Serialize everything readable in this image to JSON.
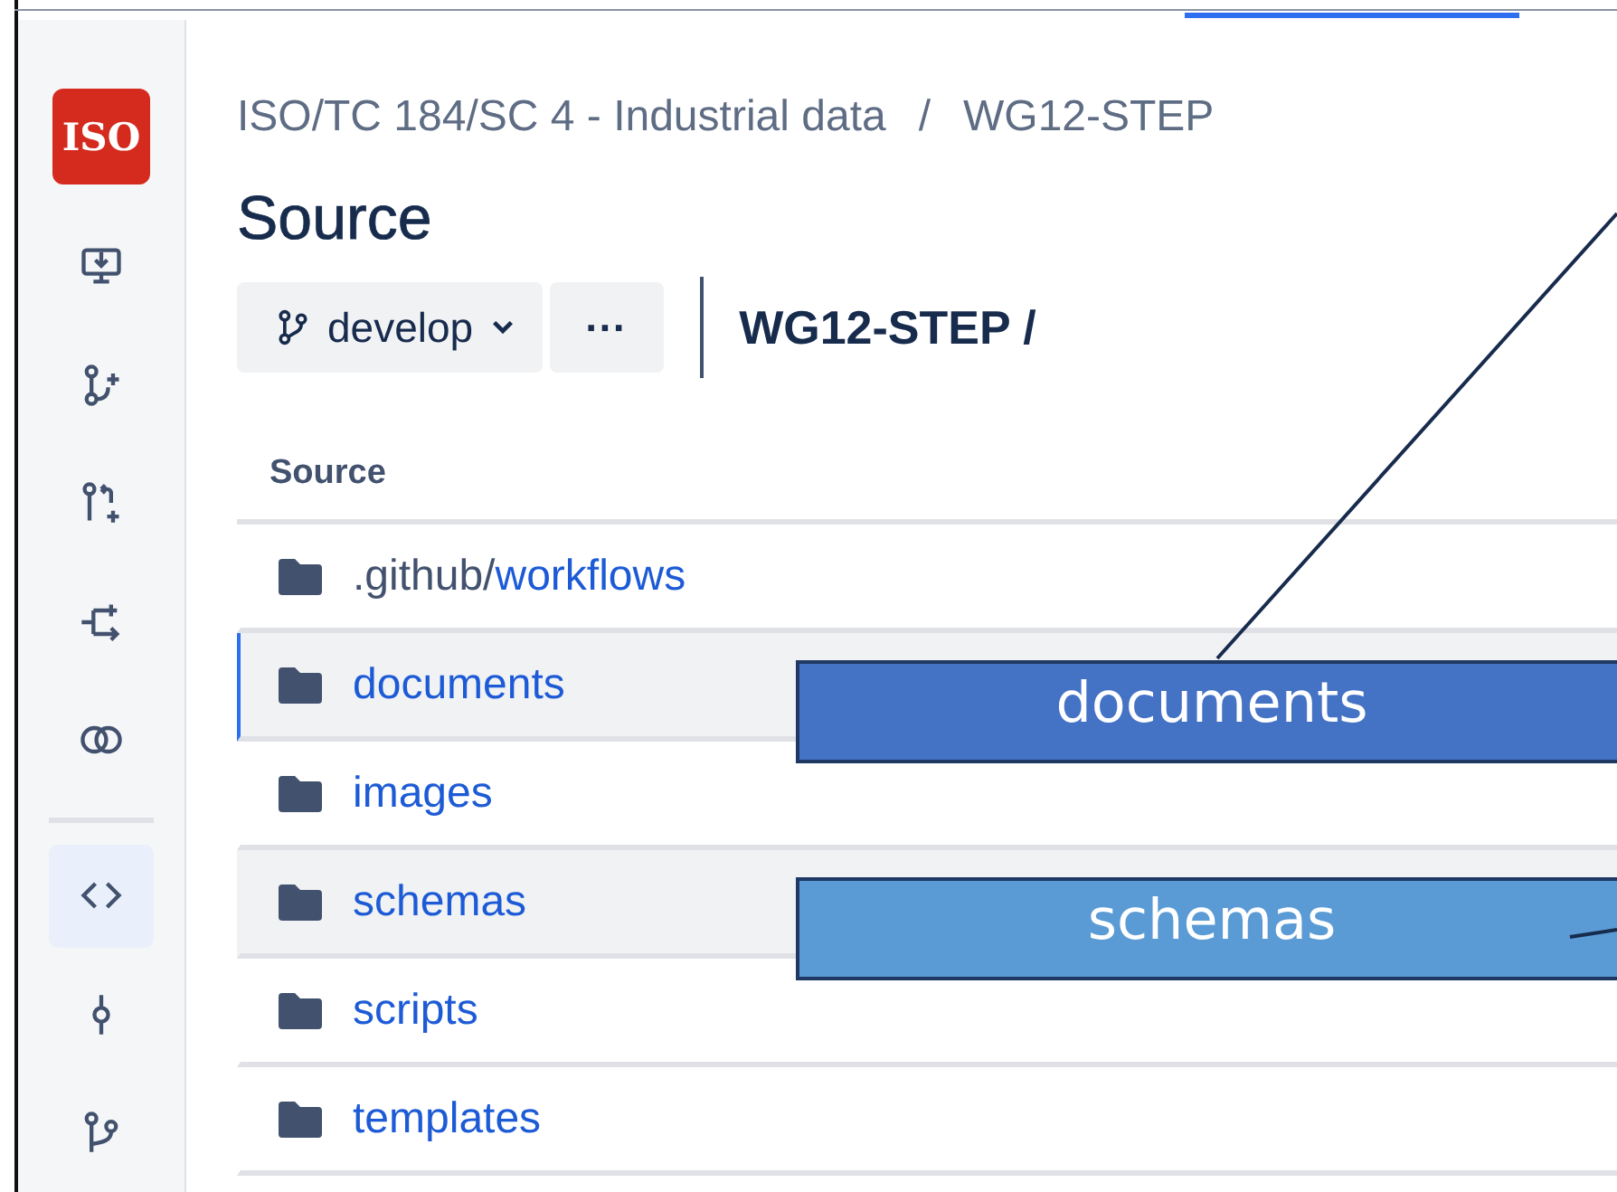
{
  "logo": {
    "text": "ISO"
  },
  "sidebar": {
    "top_items": [
      {
        "kind": "deploy",
        "selected": false
      },
      {
        "kind": "branch-create",
        "selected": false
      },
      {
        "kind": "pull-request-create",
        "selected": false
      },
      {
        "kind": "compare",
        "selected": false
      },
      {
        "kind": "rings",
        "selected": false
      }
    ],
    "bottom_items": [
      {
        "kind": "code",
        "selected": true
      },
      {
        "kind": "commit",
        "selected": false
      },
      {
        "kind": "branch",
        "selected": false
      }
    ]
  },
  "breadcrumb": [
    "ISO/TC 184/SC 4 - Industrial data",
    "WG12-STEP"
  ],
  "breadcrumb_separator": "/",
  "title": "Source",
  "toolbar": {
    "branch": "develop",
    "more": "···",
    "path": "WG12-STEP /"
  },
  "table": {
    "columns": [
      "Source"
    ],
    "rows": [
      {
        "prefix": ".github/",
        "name": "workflows",
        "selected": false,
        "hovered": false
      },
      {
        "name": "documents",
        "selected": true,
        "hovered": false
      },
      {
        "name": "images",
        "selected": false,
        "hovered": false
      },
      {
        "name": "schemas",
        "selected": false,
        "hovered": true
      },
      {
        "name": "scripts",
        "selected": false,
        "hovered": false
      },
      {
        "name": "templates",
        "selected": false,
        "hovered": false
      }
    ]
  },
  "callouts": [
    {
      "text": "documents",
      "color": "#4472c4"
    },
    {
      "text": "schemas",
      "color": "#5b9bd5"
    }
  ]
}
